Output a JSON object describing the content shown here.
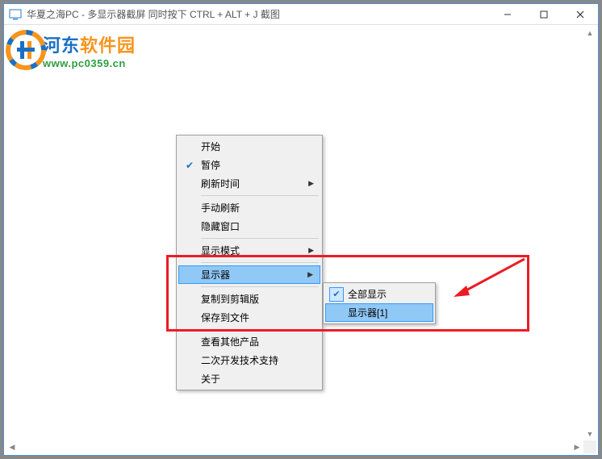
{
  "window": {
    "title": "华夏之海PC - 多显示器截屏  同时按下 CTRL + ALT + J 截图"
  },
  "watermark": {
    "name_part1": "河东",
    "name_part2": "软件园",
    "url": "www.pc0359.cn"
  },
  "menu": {
    "start": "开始",
    "pause": "暂停",
    "refresh_time": "刷新时间",
    "manual_refresh": "手动刷新",
    "hide_window": "隐藏窗口",
    "display_mode": "显示模式",
    "monitor": "显示器",
    "copy_clipboard": "复制到剪辑版",
    "save_file": "保存到文件",
    "other_products": "查看其他产品",
    "dev_support": "二次开发技术支持",
    "about": "关于"
  },
  "submenu": {
    "show_all": "全部显示",
    "monitor1": "显示器[1]"
  }
}
